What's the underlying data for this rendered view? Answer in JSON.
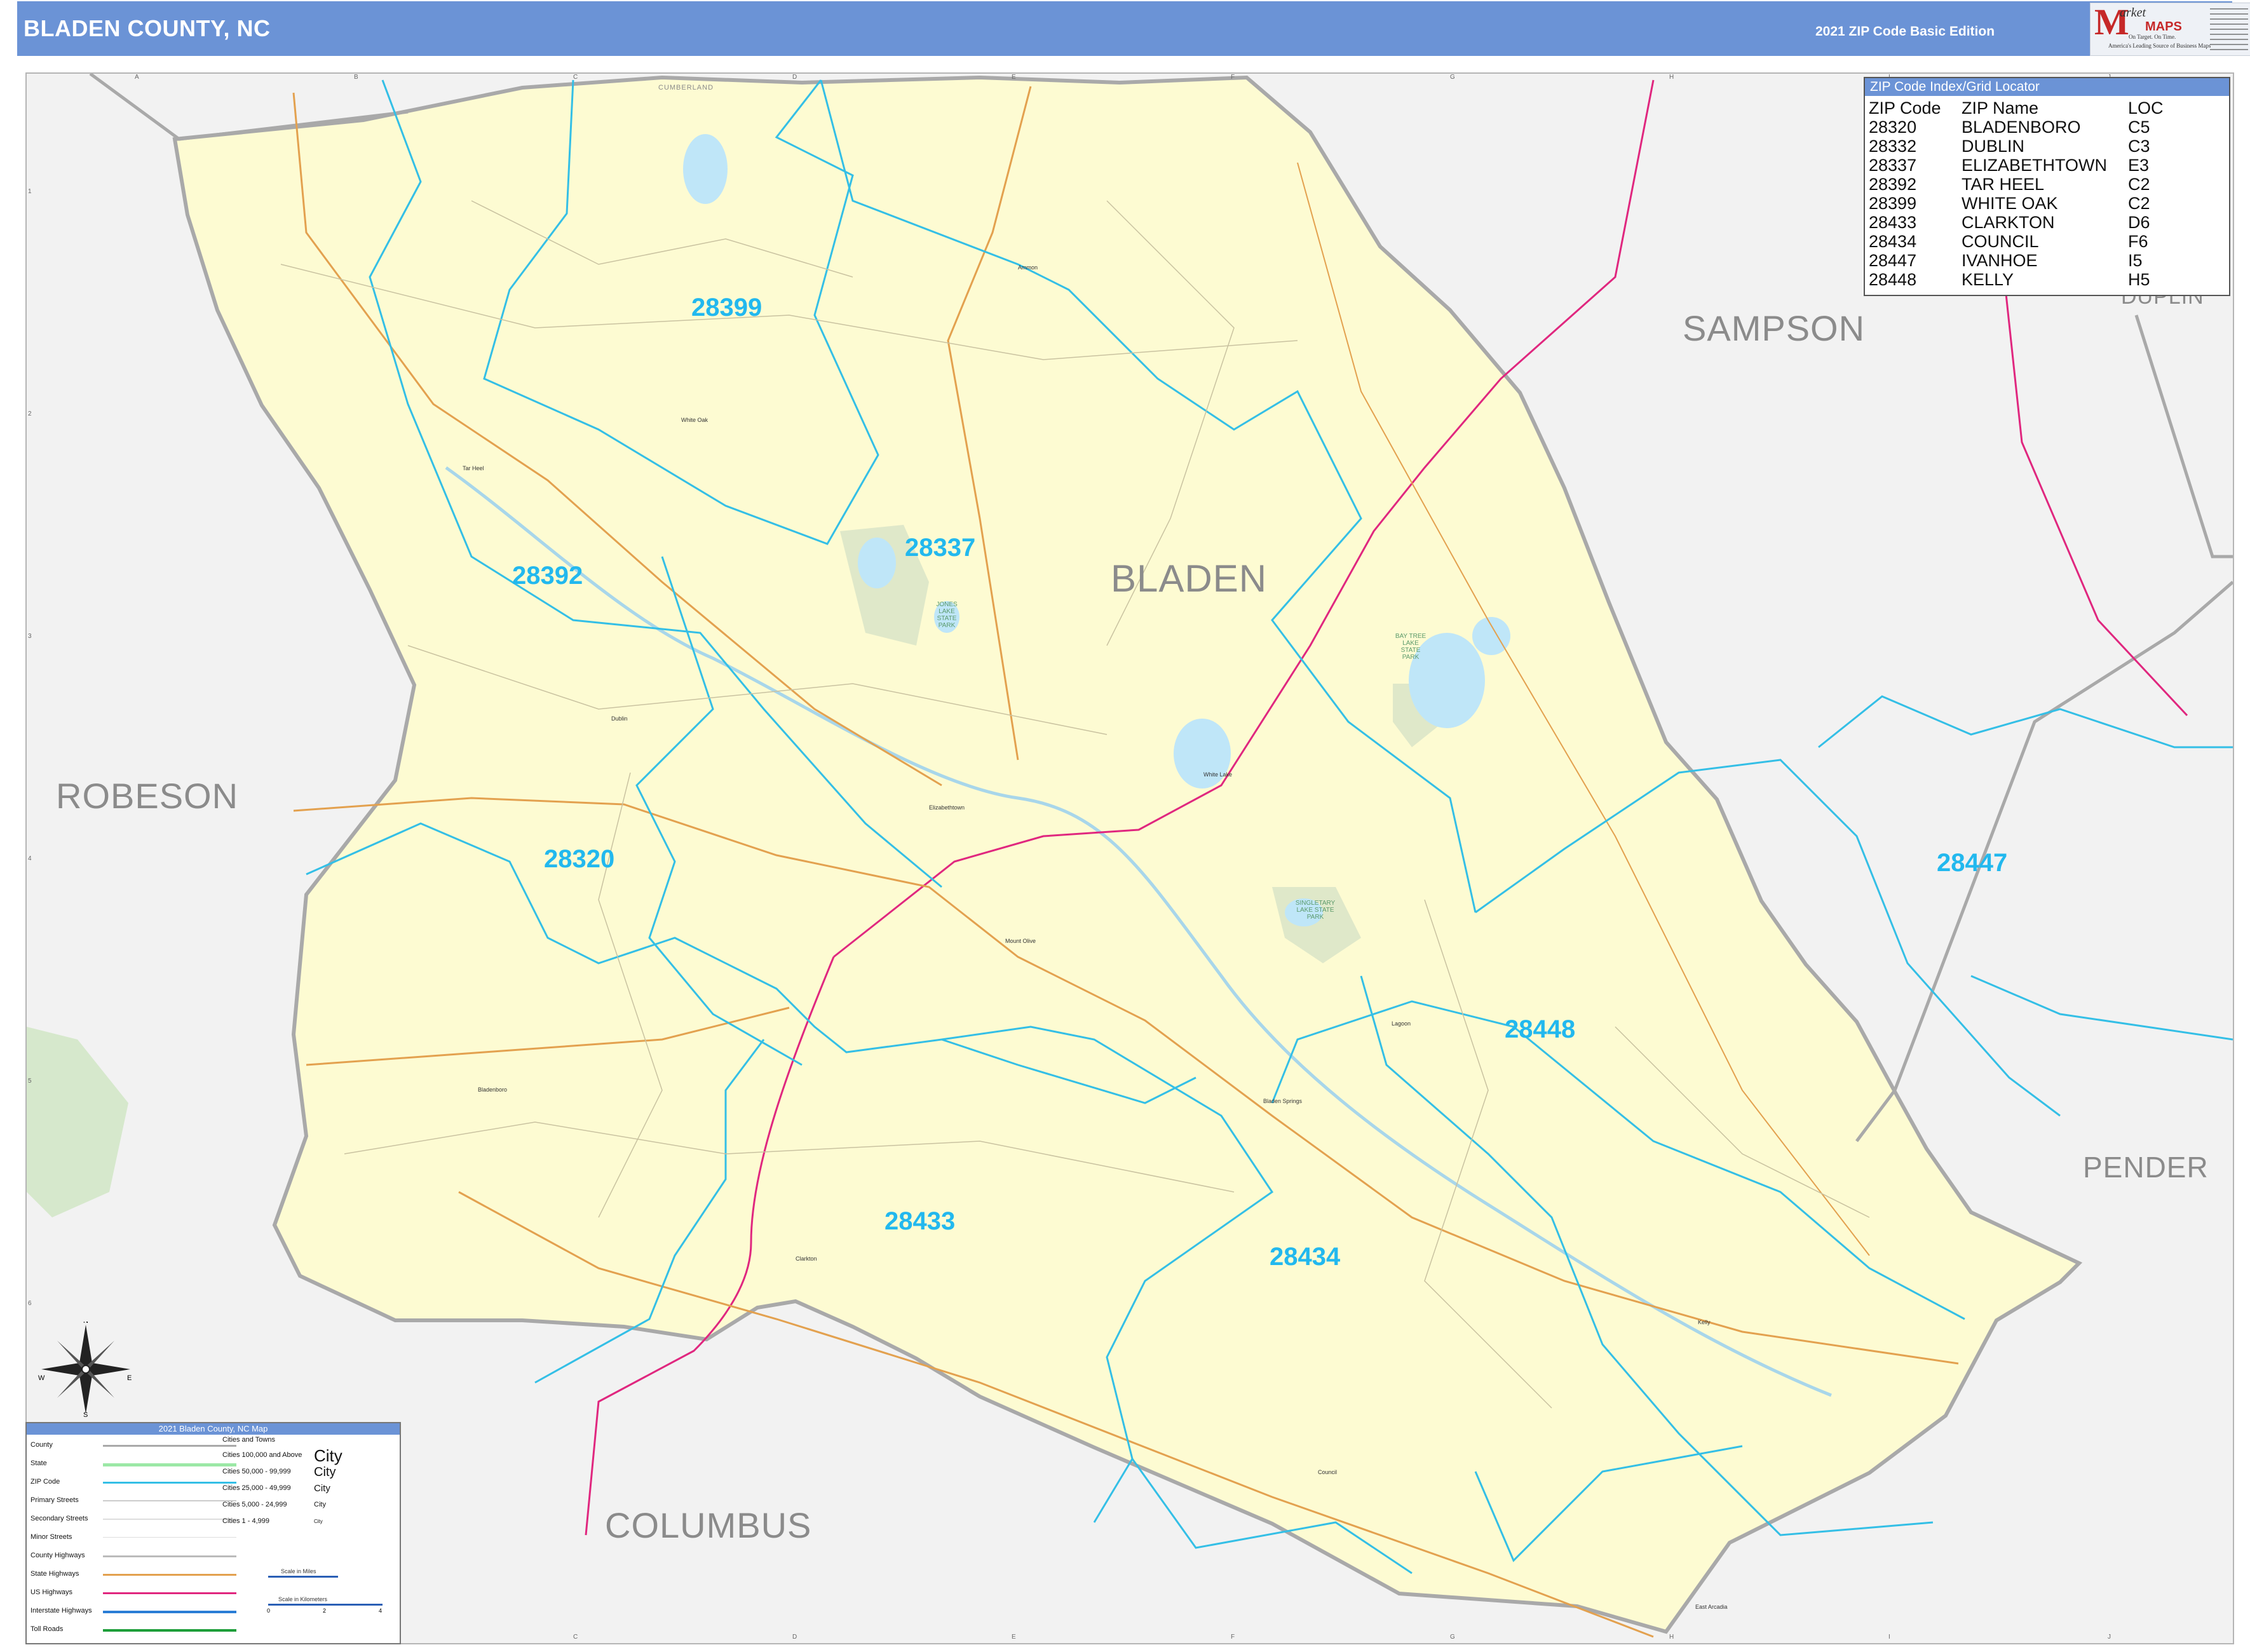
{
  "header": {
    "title": "BLADEN COUNTY, NC",
    "edition": "2021 ZIP Code Basic Edition",
    "logo": {
      "letter": "M",
      "word1": "arket",
      "word2": "MAPS",
      "tagline1": "On Target. On Time.",
      "tagline2": "America's Leading Source of Business Maps"
    }
  },
  "zip_index": {
    "title": "ZIP Code Index/Grid Locator",
    "columns": [
      "ZIP Code",
      "ZIP Name",
      "LOC"
    ],
    "rows": [
      [
        "28320",
        "BLADENBORO",
        "C5"
      ],
      [
        "28332",
        "DUBLIN",
        "C3"
      ],
      [
        "28337",
        "ELIZABETHTOWN",
        "E3"
      ],
      [
        "28392",
        "TAR HEEL",
        "C2"
      ],
      [
        "28399",
        "WHITE OAK",
        "C2"
      ],
      [
        "28433",
        "CLARKTON",
        "D6"
      ],
      [
        "28434",
        "COUNCIL",
        "F6"
      ],
      [
        "28447",
        "IVANHOE",
        "I5"
      ],
      [
        "28448",
        "KELLY",
        "H5"
      ]
    ]
  },
  "map": {
    "county_labels": {
      "bladen": "BLADEN",
      "sampson": "SAMPSON",
      "duplin": "DUPLIN",
      "robeson": "ROBESON",
      "pender": "PENDER",
      "columbus": "COLUMBUS",
      "cumberland": "CUMBERLAND"
    },
    "zip_labels": {
      "z28399": "28399",
      "z28337": "28337",
      "z28392": "28392",
      "z28320": "28320",
      "z28433": "28433",
      "z28434": "28434",
      "z28448": "28448",
      "z28447": "28447"
    },
    "towns": {
      "elizabethtown": "Elizabethtown",
      "bladenboro": "Bladenboro",
      "clarkton": "Clarkton",
      "white_lake": "White Lake",
      "dublin": "Dublin",
      "tar_heel": "Tar Heel",
      "white_oak": "White Oak",
      "kelly": "Kelly",
      "council": "Council",
      "ammon": "Ammon",
      "bladen_springs": "Bladen Springs",
      "lagoon": "Lagoon",
      "mount_olive": "Mount Olive",
      "east_arcadia": "East Arcadia"
    },
    "parks": {
      "jones_lake": "JONES LAKE STATE PARK",
      "singletary": "SINGLETARY LAKE STATE PARK",
      "bay_tree": "BAY TREE LAKE STATE PARK"
    },
    "grid_columns": [
      "A",
      "B",
      "C",
      "D",
      "E",
      "F",
      "G",
      "H",
      "I",
      "J"
    ],
    "grid_rows": [
      "1",
      "2",
      "3",
      "4",
      "5",
      "6",
      "7"
    ],
    "colors": {
      "county_fill": "#fdfbd2",
      "outside_fill": "#f2f2f2",
      "zip_boundary": "#34bfe6",
      "county_boundary": "#a9a9a9",
      "us_highway": "#e0277f",
      "state_highway": "#e3a14f",
      "water": "#bfe6f8",
      "river": "#a8d6ea",
      "park": "#dfe8c9"
    }
  },
  "legend": {
    "title": "2021 Bladen County, NC Map",
    "items": [
      "County",
      "State",
      "ZIP Code",
      "Primary Streets",
      "Secondary Streets",
      "Minor Streets",
      "County Highways",
      "State Highways",
      "US Highways",
      "Interstate Highways",
      "Toll Roads"
    ],
    "cities_header": "Cities and Towns",
    "city_classes": [
      {
        "label": "Cities 100,000 and Above",
        "sample": "City"
      },
      {
        "label": "Cities 50,000 - 99,999",
        "sample": "City"
      },
      {
        "label": "Cities 25,000 - 49,999",
        "sample": "City"
      },
      {
        "label": "Cities 5,000 - 24,999",
        "sample": "City"
      },
      {
        "label": "Cities 1 - 4,999",
        "sample": "City"
      }
    ],
    "scale_miles": "Scale in Miles",
    "scale_km": "Scale in Kilometers",
    "scale_ticks": [
      "0",
      "2",
      "4"
    ]
  },
  "compass": {
    "n": "N",
    "s": "S",
    "e": "E",
    "w": "W"
  }
}
